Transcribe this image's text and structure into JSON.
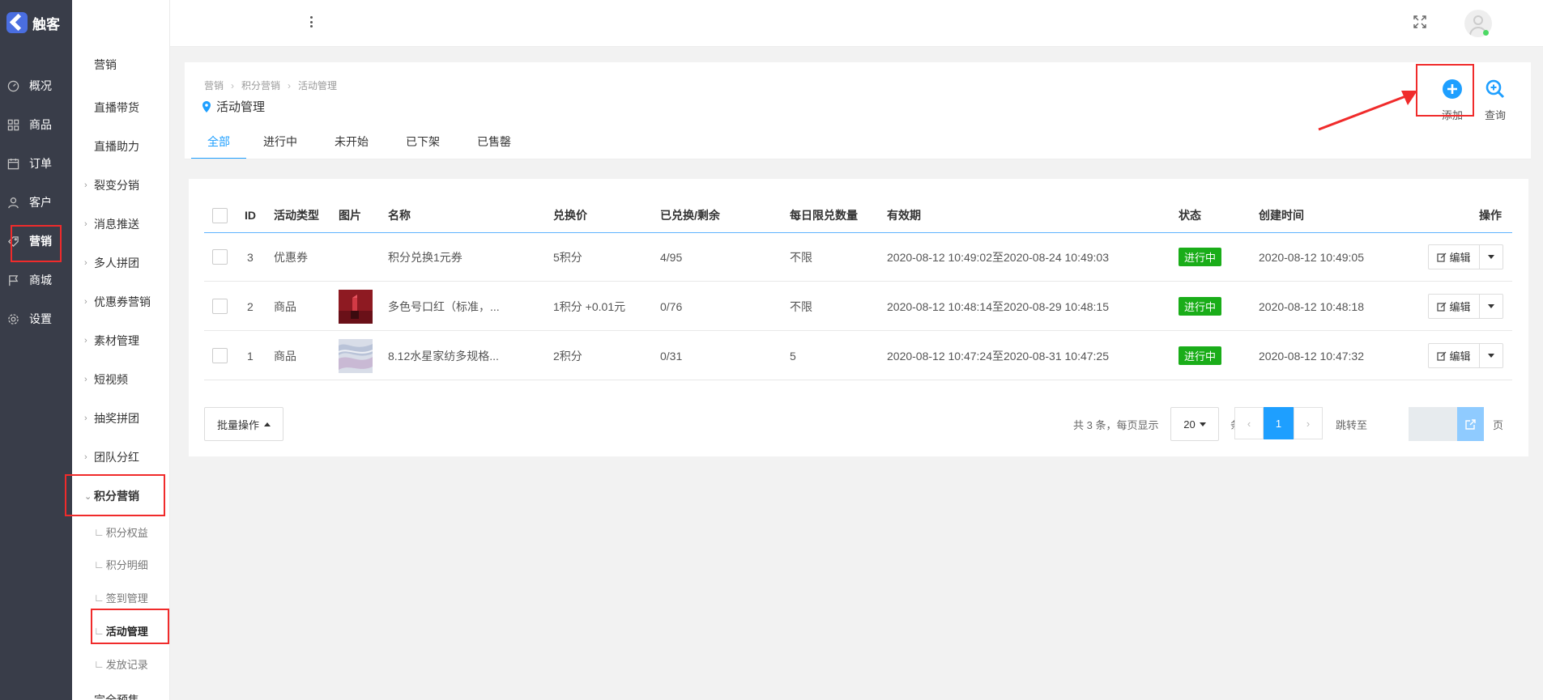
{
  "brand": {
    "name": "触客"
  },
  "main_nav": [
    {
      "label": "概况",
      "icon": "dashboard-icon"
    },
    {
      "label": "商品",
      "icon": "grid-icon"
    },
    {
      "label": "订单",
      "icon": "calendar-icon"
    },
    {
      "label": "客户",
      "icon": "user-icon"
    },
    {
      "label": "营销",
      "icon": "tag-icon",
      "active": true
    },
    {
      "label": "商城",
      "icon": "flag-icon"
    },
    {
      "label": "设置",
      "icon": "gear-icon"
    }
  ],
  "sub_nav": {
    "items": [
      {
        "label": "营销"
      },
      {
        "label": "直播带货"
      },
      {
        "label": "直播助力"
      },
      {
        "label": "裂变分销",
        "expandable": true
      },
      {
        "label": "消息推送",
        "expandable": true
      },
      {
        "label": "多人拼团",
        "expandable": true
      },
      {
        "label": "优惠券营销",
        "expandable": true
      },
      {
        "label": "素材管理",
        "expandable": true
      },
      {
        "label": "短视频",
        "expandable": true
      },
      {
        "label": "抽奖拼团",
        "expandable": true
      },
      {
        "label": "团队分红",
        "expandable": true
      },
      {
        "label": "积分营销",
        "expandable": true,
        "expanded": true
      }
    ],
    "children": [
      {
        "label": "积分权益"
      },
      {
        "label": "积分明细"
      },
      {
        "label": "签到管理"
      },
      {
        "label": "活动管理",
        "current": true
      },
      {
        "label": "发放记录"
      }
    ],
    "cutoff_item": "完全预售"
  },
  "breadcrumb": [
    "营销",
    "积分营销",
    "活动管理"
  ],
  "page_title": "活动管理",
  "tabs": [
    {
      "label": "全部",
      "active": true
    },
    {
      "label": "进行中"
    },
    {
      "label": "未开始"
    },
    {
      "label": "已下架"
    },
    {
      "label": "已售罄"
    }
  ],
  "actions": {
    "add": "添加",
    "query": "查询"
  },
  "table": {
    "columns": [
      "ID",
      "活动类型",
      "图片",
      "名称",
      "兑换价",
      "已兑换/剩余",
      "每日限兑数量",
      "有效期",
      "状态",
      "创建时间",
      "操作"
    ],
    "rows": [
      {
        "id": "3",
        "type": "优惠券",
        "image": "",
        "name": "积分兑换1元券",
        "price": "5积分",
        "exchanged": "4/95",
        "daily_limit": "不限",
        "validity": "2020-08-12 10:49:02至2020-08-24 10:49:03",
        "status": "进行中",
        "created": "2020-08-12 10:49:05",
        "edit": "编辑"
      },
      {
        "id": "2",
        "type": "商品",
        "image": "lipstick-thumbnail",
        "name": "多色号口红（标准，...",
        "price": "1积分 +0.01元",
        "exchanged": "0/76",
        "daily_limit": "不限",
        "validity": "2020-08-12 10:48:14至2020-08-29 10:48:15",
        "status": "进行中",
        "created": "2020-08-12 10:48:18",
        "edit": "编辑"
      },
      {
        "id": "1",
        "type": "商品",
        "image": "fabric-thumbnail",
        "name": "8.12水星家纺多规格...",
        "price": "2积分",
        "exchanged": "0/31",
        "daily_limit": "5",
        "validity": "2020-08-12 10:47:24至2020-08-31 10:47:25",
        "status": "进行中",
        "created": "2020-08-12 10:47:32",
        "edit": "编辑"
      }
    ]
  },
  "footer": {
    "batch": "批量操作",
    "total_text": "共 3 条，每页显示",
    "page_size": "20",
    "page_size_unit": "条",
    "prev": "‹",
    "current_page": "1",
    "next": "›",
    "goto_label": "跳转至",
    "page_unit": "页"
  },
  "colors": {
    "accent": "#1e9fff",
    "status_active": "#1aad19",
    "sidebar": "#393d49",
    "annotation": "#f02b2b"
  }
}
